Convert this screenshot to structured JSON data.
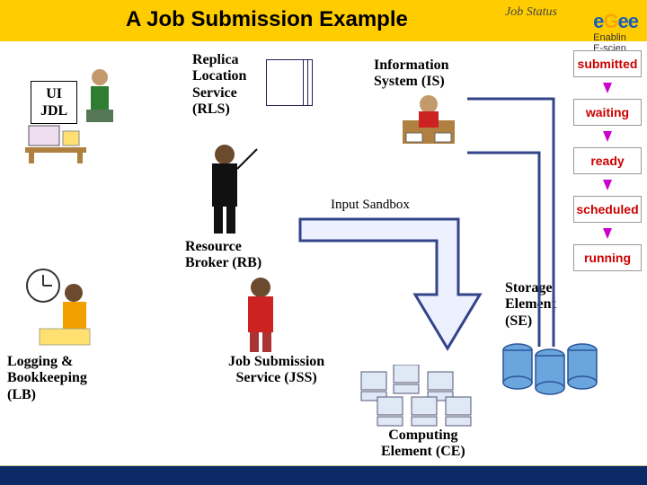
{
  "title": "A Job Submission Example",
  "corner_label": "Job Status",
  "logo": {
    "brand": "eGee",
    "tagline1": "Enablin",
    "tagline2": "E-scien"
  },
  "ui_box": {
    "line1": "UI",
    "line2": "JDL"
  },
  "components": {
    "rls": "Replica\nLocation\nService\n(RLS)",
    "is": "Information\nSystem (IS)",
    "rb": "Resource\nBroker (RB)",
    "jss": "Job Submission\nService (JSS)",
    "se": "Storage\nElement\n(SE)",
    "ce": "Computing\nElement (CE)",
    "lb": "Logging &\nBookkeeping\n(LB)",
    "input_sandbox": "Input Sandbox"
  },
  "status": [
    "submitted",
    "waiting",
    "ready",
    "scheduled",
    "running"
  ]
}
